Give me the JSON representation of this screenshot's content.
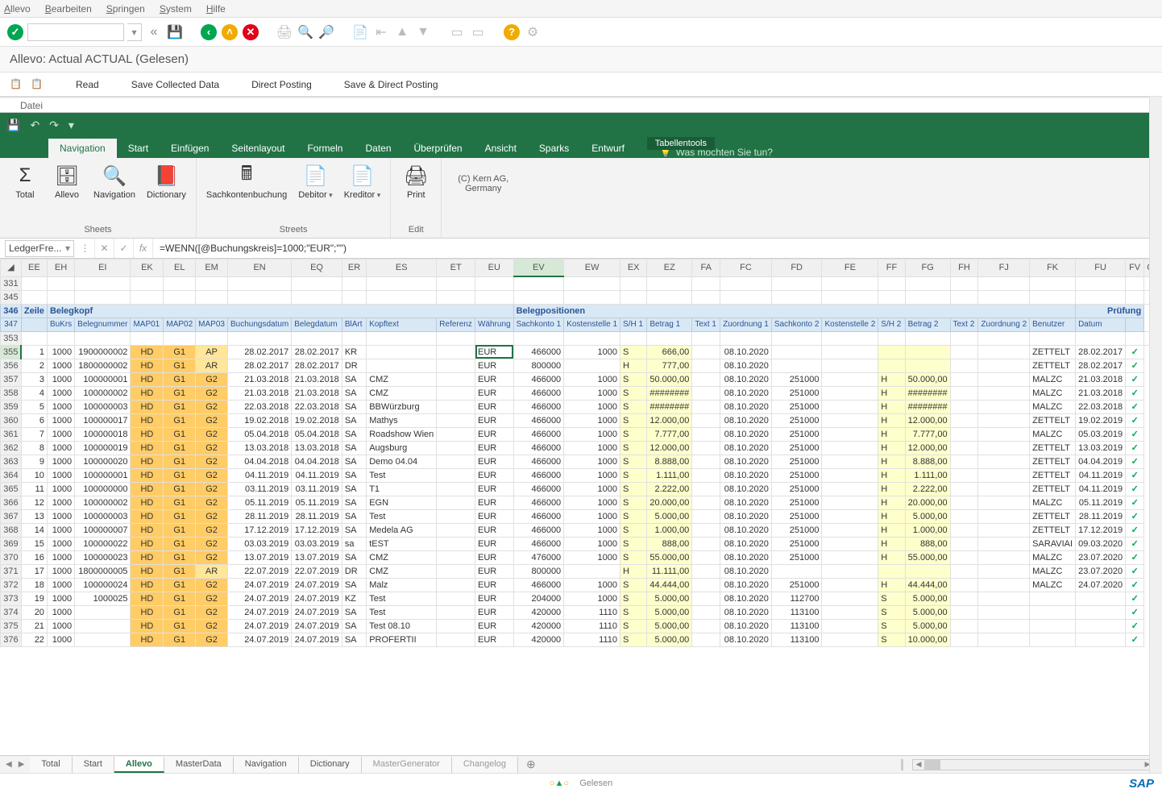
{
  "sap_menu": [
    "Allevo",
    "Bearbeiten",
    "Springen",
    "System",
    "Hilfe"
  ],
  "sap_title": "Allevo: Actual ACTUAL (Gelesen)",
  "sap_actions": [
    "Read",
    "Save Collected Data",
    "Direct Posting",
    "Save & Direct Posting"
  ],
  "datei": "Datei",
  "excel": {
    "context_tab": "Tabellentools",
    "tabs": [
      "Navigation",
      "Start",
      "Einfügen",
      "Seitenlayout",
      "Formeln",
      "Daten",
      "Überprüfen",
      "Ansicht",
      "Sparks",
      "Entwurf"
    ],
    "active_tab": "Navigation",
    "tell_me": "Was möchten Sie tun?",
    "ribbon_groups": [
      {
        "label": "Sheets",
        "items": [
          {
            "l": "Total",
            "i": "Σ"
          },
          {
            "l": "Allevo",
            "i": "🗄"
          },
          {
            "l": "Navigation",
            "i": "🔍"
          },
          {
            "l": "Dictionary",
            "i": "📕"
          }
        ]
      },
      {
        "label": "Streets",
        "items": [
          {
            "l": "Sachkontenbuchung",
            "i": "🖩"
          },
          {
            "l": "Debitor",
            "i": "📄",
            "dd": true
          },
          {
            "l": "Kreditor",
            "i": "📄",
            "dd": true
          }
        ]
      },
      {
        "label": "Edit",
        "items": [
          {
            "l": "Print",
            "i": "🖨"
          }
        ]
      }
    ],
    "kern": "(C) Kern AG,\nGermany",
    "name_box": "LedgerFre...",
    "formula": "=WENN([@Buchungskreis]=1000;\"EUR\";\"\")",
    "sheets": [
      "Total",
      "Start",
      "Allevo",
      "MasterData",
      "Navigation",
      "Dictionary",
      "MasterGenerator",
      "Changelog"
    ],
    "active_sheet": "Allevo"
  },
  "columns": [
    "EE",
    "EH",
    "EI",
    "EK",
    "EL",
    "EM",
    "EN",
    "EQ",
    "ER",
    "ES",
    "ET",
    "EU",
    "EV",
    "EW",
    "EX",
    "EZ",
    "FA",
    "FC",
    "FD",
    "FE",
    "FF",
    "FG",
    "FH",
    "FJ",
    "FK",
    "FU",
    "FV",
    "GL"
  ],
  "col_widths": [
    "c-ee",
    "c-eh",
    "c-ei",
    "c-ek",
    "c-el",
    "c-em",
    "c-en",
    "c-eq",
    "c-er",
    "c-es",
    "c-et",
    "c-eu",
    "c-ev",
    "c-ew",
    "c-ex",
    "c-ez",
    "c-fa",
    "c-fc",
    "c-fd",
    "c-fe",
    "c-ff",
    "c-fg",
    "c-fh",
    "c-fj",
    "c-fk",
    "c-fu",
    "c-fv",
    "c-gl"
  ],
  "selected_col": "EV",
  "row_labels": [
    "331",
    "345",
    "346",
    "347",
    "353",
    "355",
    "356",
    "357",
    "358",
    "359",
    "360",
    "361",
    "362",
    "363",
    "364",
    "365",
    "366",
    "367",
    "368",
    "369",
    "370",
    "371",
    "372",
    "373",
    "374",
    "375",
    "376"
  ],
  "section1": {
    "row": "346",
    "label_a": "Zeile",
    "label_b": "Belegkopf",
    "label_c": "Belegpositionen",
    "label_d": "Prüfung"
  },
  "headers": [
    "",
    "BuKrs",
    "Belegnummer",
    "MAP01",
    "MAP02",
    "MAP03",
    "Buchungsdatum",
    "Belegdatum",
    "BlArt",
    "Kopftext",
    "Referenz",
    "Währung",
    "Sachkonto 1",
    "Kostenstelle 1",
    "S/H 1",
    "Betrag 1",
    "Text 1",
    "Zuordnung 1",
    "Sachkonto 2",
    "Kostenstelle 2",
    "S/H 2",
    "Betrag 2",
    "Text 2",
    "Zuordnung 2",
    "Benutzer",
    "Datum",
    ""
  ],
  "rows": [
    {
      "r": "355",
      "z": "1",
      "bk": "1000",
      "bn": "1900000002",
      "m1": "HD",
      "m2": "G1",
      "m3": "AP",
      "bd": "28.02.2017",
      "bld": "28.02.2017",
      "ba": "KR",
      "kt": "",
      "rf": "",
      "w": "EUR",
      "sk1": "466000",
      "ks1": "1000",
      "sh1": "S",
      "bt1": "666,00",
      "zo1": "08.10.2020",
      "sk2": "",
      "ks2": "",
      "sh2": "",
      "bt2": "",
      "ben": "ZETTELT",
      "dat": "28.02.2017"
    },
    {
      "r": "356",
      "z": "2",
      "bk": "1000",
      "bn": "1800000002",
      "m1": "HD",
      "m2": "G1",
      "m3": "AR",
      "bd": "28.02.2017",
      "bld": "28.02.2017",
      "ba": "DR",
      "kt": "",
      "rf": "",
      "w": "EUR",
      "sk1": "800000",
      "ks1": "",
      "sh1": "H",
      "bt1": "777,00",
      "zo1": "08.10.2020",
      "sk2": "",
      "ks2": "",
      "sh2": "",
      "bt2": "",
      "ben": "ZETTELT",
      "dat": "28.02.2017"
    },
    {
      "r": "357",
      "z": "3",
      "bk": "1000",
      "bn": "100000001",
      "m1": "HD",
      "m2": "G1",
      "m3": "G2",
      "bd": "21.03.2018",
      "bld": "21.03.2018",
      "ba": "SA",
      "kt": "CMZ",
      "rf": "",
      "w": "EUR",
      "sk1": "466000",
      "ks1": "1000",
      "sh1": "S",
      "bt1": "50.000,00",
      "zo1": "08.10.2020",
      "sk2": "251000",
      "ks2": "",
      "sh2": "H",
      "bt2": "50.000,00",
      "ben": "MALZC",
      "dat": "21.03.2018"
    },
    {
      "r": "358",
      "z": "4",
      "bk": "1000",
      "bn": "100000002",
      "m1": "HD",
      "m2": "G1",
      "m3": "G2",
      "bd": "21.03.2018",
      "bld": "21.03.2018",
      "ba": "SA",
      "kt": "CMZ",
      "rf": "",
      "w": "EUR",
      "sk1": "466000",
      "ks1": "1000",
      "sh1": "S",
      "bt1": "########",
      "zo1": "08.10.2020",
      "sk2": "251000",
      "ks2": "",
      "sh2": "H",
      "bt2": "########",
      "ben": "MALZC",
      "dat": "21.03.2018"
    },
    {
      "r": "359",
      "z": "5",
      "bk": "1000",
      "bn": "100000003",
      "m1": "HD",
      "m2": "G1",
      "m3": "G2",
      "bd": "22.03.2018",
      "bld": "22.03.2018",
      "ba": "SA",
      "kt": "BBWürzburg",
      "rf": "",
      "w": "EUR",
      "sk1": "466000",
      "ks1": "1000",
      "sh1": "S",
      "bt1": "########",
      "zo1": "08.10.2020",
      "sk2": "251000",
      "ks2": "",
      "sh2": "H",
      "bt2": "########",
      "ben": "MALZC",
      "dat": "22.03.2018"
    },
    {
      "r": "360",
      "z": "6",
      "bk": "1000",
      "bn": "100000017",
      "m1": "HD",
      "m2": "G1",
      "m3": "G2",
      "bd": "19.02.2018",
      "bld": "19.02.2018",
      "ba": "SA",
      "kt": "Mathys",
      "rf": "",
      "w": "EUR",
      "sk1": "466000",
      "ks1": "1000",
      "sh1": "S",
      "bt1": "12.000,00",
      "zo1": "08.10.2020",
      "sk2": "251000",
      "ks2": "",
      "sh2": "H",
      "bt2": "12.000,00",
      "ben": "ZETTELT",
      "dat": "19.02.2019"
    },
    {
      "r": "361",
      "z": "7",
      "bk": "1000",
      "bn": "100000018",
      "m1": "HD",
      "m2": "G1",
      "m3": "G2",
      "bd": "05.04.2018",
      "bld": "05.04.2018",
      "ba": "SA",
      "kt": "Roadshow Wien",
      "rf": "",
      "w": "EUR",
      "sk1": "466000",
      "ks1": "1000",
      "sh1": "S",
      "bt1": "7.777,00",
      "zo1": "08.10.2020",
      "sk2": "251000",
      "ks2": "",
      "sh2": "H",
      "bt2": "7.777,00",
      "ben": "MALZC",
      "dat": "05.03.2019"
    },
    {
      "r": "362",
      "z": "8",
      "bk": "1000",
      "bn": "100000019",
      "m1": "HD",
      "m2": "G1",
      "m3": "G2",
      "bd": "13.03.2018",
      "bld": "13.03.2018",
      "ba": "SA",
      "kt": "Augsburg",
      "rf": "",
      "w": "EUR",
      "sk1": "466000",
      "ks1": "1000",
      "sh1": "S",
      "bt1": "12.000,00",
      "zo1": "08.10.2020",
      "sk2": "251000",
      "ks2": "",
      "sh2": "H",
      "bt2": "12.000,00",
      "ben": "ZETTELT",
      "dat": "13.03.2019"
    },
    {
      "r": "363",
      "z": "9",
      "bk": "1000",
      "bn": "100000020",
      "m1": "HD",
      "m2": "G1",
      "m3": "G2",
      "bd": "04.04.2018",
      "bld": "04.04.2018",
      "ba": "SA",
      "kt": "Demo 04.04",
      "rf": "",
      "w": "EUR",
      "sk1": "466000",
      "ks1": "1000",
      "sh1": "S",
      "bt1": "8.888,00",
      "zo1": "08.10.2020",
      "sk2": "251000",
      "ks2": "",
      "sh2": "H",
      "bt2": "8.888,00",
      "ben": "ZETTELT",
      "dat": "04.04.2019"
    },
    {
      "r": "364",
      "z": "10",
      "bk": "1000",
      "bn": "100000001",
      "m1": "HD",
      "m2": "G1",
      "m3": "G2",
      "bd": "04.11.2019",
      "bld": "04.11.2019",
      "ba": "SA",
      "kt": "Test",
      "rf": "",
      "w": "EUR",
      "sk1": "466000",
      "ks1": "1000",
      "sh1": "S",
      "bt1": "1.111,00",
      "zo1": "08.10.2020",
      "sk2": "251000",
      "ks2": "",
      "sh2": "H",
      "bt2": "1.111,00",
      "ben": "ZETTELT",
      "dat": "04.11.2019"
    },
    {
      "r": "365",
      "z": "11",
      "bk": "1000",
      "bn": "100000000",
      "m1": "HD",
      "m2": "G1",
      "m3": "G2",
      "bd": "03.11.2019",
      "bld": "03.11.2019",
      "ba": "SA",
      "kt": "T1",
      "rf": "",
      "w": "EUR",
      "sk1": "466000",
      "ks1": "1000",
      "sh1": "S",
      "bt1": "2.222,00",
      "zo1": "08.10.2020",
      "sk2": "251000",
      "ks2": "",
      "sh2": "H",
      "bt2": "2.222,00",
      "ben": "ZETTELT",
      "dat": "04.11.2019"
    },
    {
      "r": "366",
      "z": "12",
      "bk": "1000",
      "bn": "100000002",
      "m1": "HD",
      "m2": "G1",
      "m3": "G2",
      "bd": "05.11.2019",
      "bld": "05.11.2019",
      "ba": "SA",
      "kt": "EGN",
      "rf": "",
      "w": "EUR",
      "sk1": "466000",
      "ks1": "1000",
      "sh1": "S",
      "bt1": "20.000,00",
      "zo1": "08.10.2020",
      "sk2": "251000",
      "ks2": "",
      "sh2": "H",
      "bt2": "20.000,00",
      "ben": "MALZC",
      "dat": "05.11.2019"
    },
    {
      "r": "367",
      "z": "13",
      "bk": "1000",
      "bn": "100000003",
      "m1": "HD",
      "m2": "G1",
      "m3": "G2",
      "bd": "28.11.2019",
      "bld": "28.11.2019",
      "ba": "SA",
      "kt": "Test",
      "rf": "",
      "w": "EUR",
      "sk1": "466000",
      "ks1": "1000",
      "sh1": "S",
      "bt1": "5.000,00",
      "zo1": "08.10.2020",
      "sk2": "251000",
      "ks2": "",
      "sh2": "H",
      "bt2": "5.000,00",
      "ben": "ZETTELT",
      "dat": "28.11.2019"
    },
    {
      "r": "368",
      "z": "14",
      "bk": "1000",
      "bn": "100000007",
      "m1": "HD",
      "m2": "G1",
      "m3": "G2",
      "bd": "17.12.2019",
      "bld": "17.12.2019",
      "ba": "SA",
      "kt": "Medela AG",
      "rf": "",
      "w": "EUR",
      "sk1": "466000",
      "ks1": "1000",
      "sh1": "S",
      "bt1": "1.000,00",
      "zo1": "08.10.2020",
      "sk2": "251000",
      "ks2": "",
      "sh2": "H",
      "bt2": "1.000,00",
      "ben": "ZETTELT",
      "dat": "17.12.2019"
    },
    {
      "r": "369",
      "z": "15",
      "bk": "1000",
      "bn": "100000022",
      "m1": "HD",
      "m2": "G1",
      "m3": "G2",
      "bd": "03.03.2019",
      "bld": "03.03.2019",
      "ba": "sa",
      "kt": "tEST",
      "rf": "",
      "w": "EUR",
      "sk1": "466000",
      "ks1": "1000",
      "sh1": "S",
      "bt1": "888,00",
      "zo1": "08.10.2020",
      "sk2": "251000",
      "ks2": "",
      "sh2": "H",
      "bt2": "888,00",
      "ben": "SARAVIAI",
      "dat": "09.03.2020"
    },
    {
      "r": "370",
      "z": "16",
      "bk": "1000",
      "bn": "100000023",
      "m1": "HD",
      "m2": "G1",
      "m3": "G2",
      "bd": "13.07.2019",
      "bld": "13.07.2019",
      "ba": "SA",
      "kt": "CMZ",
      "rf": "",
      "w": "EUR",
      "sk1": "476000",
      "ks1": "1000",
      "sh1": "S",
      "bt1": "55.000,00",
      "zo1": "08.10.2020",
      "sk2": "251000",
      "ks2": "",
      "sh2": "H",
      "bt2": "55.000,00",
      "ben": "MALZC",
      "dat": "23.07.2020"
    },
    {
      "r": "371",
      "z": "17",
      "bk": "1000",
      "bn": "1800000005",
      "m1": "HD",
      "m2": "G1",
      "m3": "AR",
      "bd": "22.07.2019",
      "bld": "22.07.2019",
      "ba": "DR",
      "kt": "CMZ",
      "rf": "",
      "w": "EUR",
      "sk1": "800000",
      "ks1": "",
      "sh1": "H",
      "bt1": "11.111,00",
      "zo1": "08.10.2020",
      "sk2": "",
      "ks2": "",
      "sh2": "",
      "bt2": "",
      "ben": "MALZC",
      "dat": "23.07.2020"
    },
    {
      "r": "372",
      "z": "18",
      "bk": "1000",
      "bn": "100000024",
      "m1": "HD",
      "m2": "G1",
      "m3": "G2",
      "bd": "24.07.2019",
      "bld": "24.07.2019",
      "ba": "SA",
      "kt": "Malz",
      "rf": "",
      "w": "EUR",
      "sk1": "466000",
      "ks1": "1000",
      "sh1": "S",
      "bt1": "44.444,00",
      "zo1": "08.10.2020",
      "sk2": "251000",
      "ks2": "",
      "sh2": "H",
      "bt2": "44.444,00",
      "ben": "MALZC",
      "dat": "24.07.2020"
    },
    {
      "r": "373",
      "z": "19",
      "bk": "1000",
      "bn": "1000025",
      "m1": "HD",
      "m2": "G1",
      "m3": "G2",
      "bd": "24.07.2019",
      "bld": "24.07.2019",
      "ba": "KZ",
      "kt": "Test",
      "rf": "",
      "w": "EUR",
      "sk1": "204000",
      "ks1": "1000",
      "sh1": "S",
      "bt1": "5.000,00",
      "zo1": "08.10.2020",
      "sk2": "112700",
      "ks2": "",
      "sh2": "S",
      "bt2": "5.000,00",
      "ben": "",
      "dat": ""
    },
    {
      "r": "374",
      "z": "20",
      "bk": "1000",
      "bn": "",
      "m1": "HD",
      "m2": "G1",
      "m3": "G2",
      "bd": "24.07.2019",
      "bld": "24.07.2019",
      "ba": "SA",
      "kt": "Test",
      "rf": "",
      "w": "EUR",
      "sk1": "420000",
      "ks1": "1110",
      "sh1": "S",
      "bt1": "5.000,00",
      "zo1": "08.10.2020",
      "sk2": "113100",
      "ks2": "",
      "sh2": "S",
      "bt2": "5.000,00",
      "ben": "",
      "dat": ""
    },
    {
      "r": "375",
      "z": "21",
      "bk": "1000",
      "bn": "",
      "m1": "HD",
      "m2": "G1",
      "m3": "G2",
      "bd": "24.07.2019",
      "bld": "24.07.2019",
      "ba": "SA",
      "kt": "Test 08.10",
      "rf": "",
      "w": "EUR",
      "sk1": "420000",
      "ks1": "1110",
      "sh1": "S",
      "bt1": "5.000,00",
      "zo1": "08.10.2020",
      "sk2": "113100",
      "ks2": "",
      "sh2": "S",
      "bt2": "5.000,00",
      "ben": "",
      "dat": ""
    },
    {
      "r": "376",
      "z": "22",
      "bk": "1000",
      "bn": "",
      "m1": "HD",
      "m2": "G1",
      "m3": "G2",
      "bd": "24.07.2019",
      "bld": "24.07.2019",
      "ba": "SA",
      "kt": "PROFERTII",
      "rf": "",
      "w": "EUR",
      "sk1": "420000",
      "ks1": "1110",
      "sh1": "S",
      "bt1": "5.000,00",
      "zo1": "08.10.2020",
      "sk2": "113100",
      "ks2": "",
      "sh2": "S",
      "bt2": "10.000,00",
      "ben": "",
      "dat": ""
    }
  ],
  "status": "Gelesen",
  "sap_logo": "SAP"
}
